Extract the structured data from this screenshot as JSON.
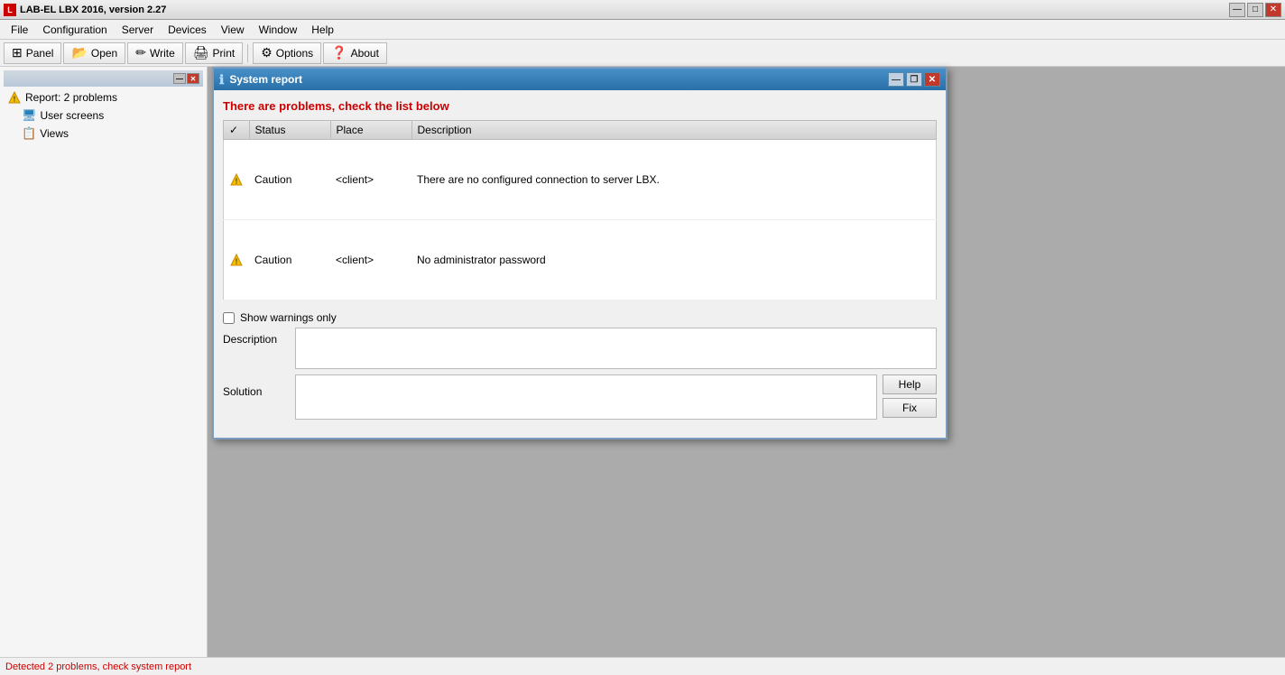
{
  "window": {
    "title": "LAB-EL LBX 2016, version 2.27",
    "title_icon": "L",
    "controls": {
      "minimize": "—",
      "maximize": "□",
      "close": "✕"
    }
  },
  "menu": {
    "items": [
      "File",
      "Configuration",
      "Server",
      "Devices",
      "View",
      "Window",
      "Help"
    ]
  },
  "toolbar": {
    "buttons": [
      {
        "label": "Panel",
        "icon": "⊞"
      },
      {
        "label": "Open",
        "icon": "📂"
      },
      {
        "label": "Write",
        "icon": "✏"
      },
      {
        "label": "Print",
        "icon": "🖨"
      },
      {
        "label": "Options",
        "icon": "⚙"
      },
      {
        "label": "About",
        "icon": "❓"
      }
    ]
  },
  "sidebar": {
    "title": "",
    "items": [
      {
        "label": "Report: 2 problems",
        "icon": "warning",
        "indent": 0
      },
      {
        "label": "User screens",
        "icon": "screen",
        "indent": 1
      },
      {
        "label": "Views",
        "icon": "view",
        "indent": 1
      }
    ]
  },
  "dialog": {
    "title": "System report",
    "title_icon": "ℹ",
    "controls": {
      "minimize": "—",
      "restore": "❐",
      "close": "✕"
    },
    "problems_header": "There are problems, check the list below",
    "table": {
      "columns": [
        "✓",
        "Status",
        "Place",
        "Description"
      ],
      "rows": [
        {
          "icon": "warning",
          "status": "Caution",
          "place": "<client>",
          "description": "There are no configured connection to server LBX."
        },
        {
          "icon": "warning",
          "status": "Caution",
          "place": "<client>",
          "description": "No administrator password"
        }
      ]
    },
    "show_warnings_label": "Show warnings only",
    "description_label": "Description",
    "solution_label": "Solution",
    "buttons": {
      "help": "Help",
      "fix": "Fix"
    }
  },
  "status_bar": {
    "text": "Detected 2 problems, check system report"
  }
}
